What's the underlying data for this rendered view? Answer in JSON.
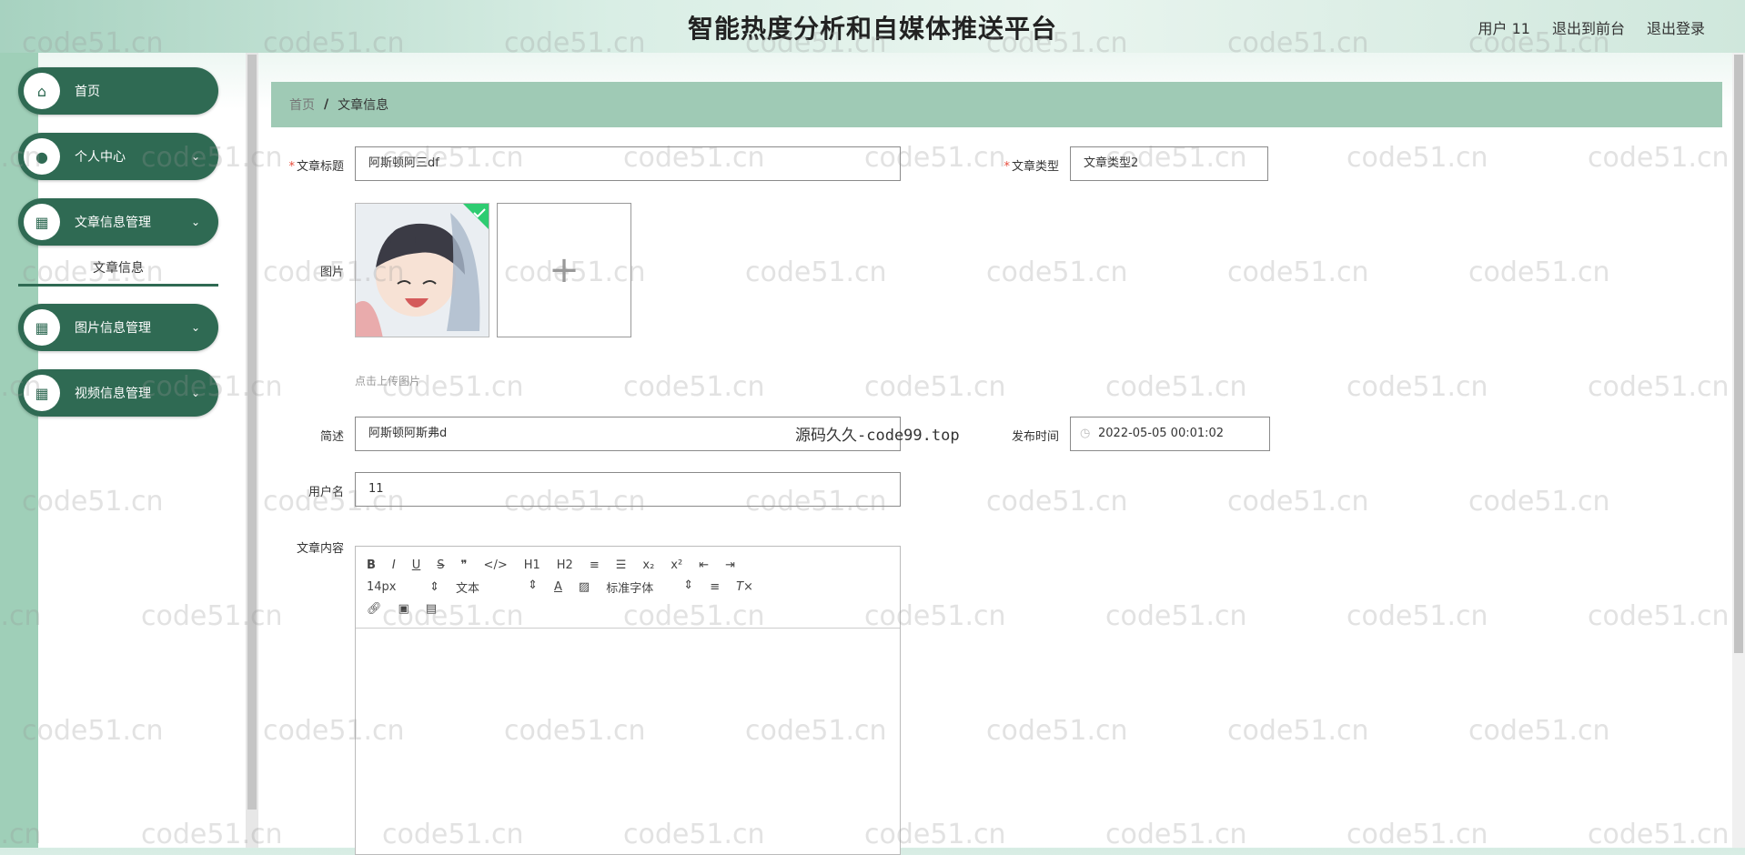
{
  "header": {
    "title": "智能热度分析和自媒体推送平台",
    "user": "用户 11",
    "to_front": "退出到前台",
    "logout": "退出登录"
  },
  "sidebar": {
    "items": [
      {
        "label": "首页",
        "icon": "home-icon"
      },
      {
        "label": "个人中心",
        "icon": "user-icon"
      },
      {
        "label": "文章信息管理",
        "icon": "grid-icon"
      },
      {
        "label": "图片信息管理",
        "icon": "grid-icon"
      },
      {
        "label": "视频信息管理",
        "icon": "grid-icon"
      }
    ],
    "submenu": "文章信息"
  },
  "breadcrumb": {
    "home": "首页",
    "sep": "/",
    "current": "文章信息"
  },
  "form": {
    "title_label": "文章标题",
    "title_value": "阿斯顿阿三df",
    "type_label": "文章类型",
    "type_value": "文章类型2",
    "image_label": "图片",
    "upload_tip": "点击上传图片",
    "summary_label": "简述",
    "summary_value": "阿斯顿阿斯弗d",
    "time_label": "发布时间",
    "time_value": "2022-05-05 00:01:02",
    "username_label": "用户名",
    "username_value": "11",
    "content_label": "文章内容"
  },
  "editor": {
    "size": "14px",
    "header": "文本",
    "font": "标准字体",
    "buttons_row1": [
      "B",
      "I",
      "U",
      "S",
      "❞",
      "</>",
      "H1",
      "H2",
      "≡",
      "☰",
      "x₂",
      "x²",
      "⇤",
      "⇥"
    ]
  },
  "watermark": "code51.cn",
  "source_mark": "源码久久-code99.top",
  "colors": {
    "sidebar": "#2f6a53",
    "breadcrumb_bg": "#9fcab5",
    "left_strip": "#9fcfb8"
  }
}
